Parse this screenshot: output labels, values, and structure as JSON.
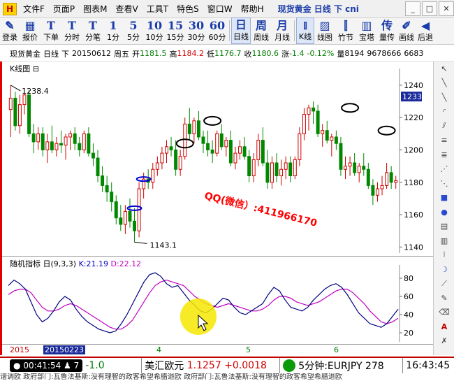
{
  "menubar": {
    "logo": "H",
    "items": [
      "文件F",
      "页面P",
      "图表M",
      "查看V",
      "工具T",
      "特色S",
      "窗口W",
      "帮助H"
    ],
    "title": "现货黄金 日线 下 cni",
    "window_buttons": [
      "_",
      "□",
      "✕"
    ]
  },
  "toolbar": {
    "buttons": [
      {
        "icon": "✎",
        "label": "登录"
      },
      {
        "icon": "▦",
        "label": "报价"
      },
      {
        "icon": "T",
        "label": "下单"
      },
      {
        "icon": "T",
        "label": "分时"
      },
      {
        "icon": "T",
        "label": "分笔"
      },
      {
        "icon": "1",
        "label": "1分"
      },
      {
        "icon": "5",
        "label": "5分"
      },
      {
        "icon": "10",
        "label": "10分"
      },
      {
        "icon": "15",
        "label": "15分"
      },
      {
        "icon": "30",
        "label": "30分"
      },
      {
        "icon": "60",
        "label": "60分"
      },
      {
        "icon": "日",
        "label": "日线"
      },
      {
        "icon": "周",
        "label": "周线"
      },
      {
        "icon": "月",
        "label": "月线"
      },
      {
        "icon": "⫾",
        "label": "K线"
      },
      {
        "icon": "▨",
        "label": "线图"
      },
      {
        "icon": "⫿",
        "label": "竹节"
      },
      {
        "icon": "▥",
        "label": "宝塔"
      },
      {
        "icon": "传",
        "label": "量传"
      },
      {
        "icon": "✐",
        "label": "画线"
      },
      {
        "icon": "◀",
        "label": "后退"
      }
    ]
  },
  "info": {
    "symbol": "现货黄金",
    "period": "日线",
    "mode": "下",
    "date": "20150612",
    "weekday": "周五",
    "open_label": "开",
    "open": "1181.5",
    "high_label": "高",
    "high": "1184.2",
    "low_label": "低",
    "low": "1176.7",
    "close_label": "收",
    "close": "1180.6",
    "change_label": "涨",
    "change": "-1.4",
    "change_pct": "-0.12%",
    "volume_label": "量",
    "volume": "8194",
    "amount": "9678666",
    "extra": "6683"
  },
  "chart": {
    "label": "K线图",
    "label_icon": "⊟",
    "watermark": "QQ(微信）:411966170",
    "high_marker": "1238.4",
    "low_marker": "1143.1",
    "current_price": "1233",
    "colors": {
      "up": "#d00000",
      "down": "#008800",
      "marker_blue": "#0000d0",
      "watermark": "#ff0000"
    }
  },
  "chart_data": {
    "type": "candlestick",
    "ylim": [
      1138,
      1246
    ],
    "y_ticks": [
      1140,
      1160,
      1180,
      1200,
      1220,
      1240
    ],
    "candles": [
      {
        "o": 1225,
        "h": 1240,
        "l": 1208,
        "c": 1232
      },
      {
        "o": 1232,
        "h": 1236,
        "l": 1212,
        "c": 1215
      },
      {
        "o": 1215,
        "h": 1234,
        "l": 1210,
        "c": 1228
      },
      {
        "o": 1228,
        "h": 1238,
        "l": 1222,
        "c": 1234
      },
      {
        "o": 1234,
        "h": 1237,
        "l": 1208,
        "c": 1210
      },
      {
        "o": 1210,
        "h": 1216,
        "l": 1198,
        "c": 1205
      },
      {
        "o": 1205,
        "h": 1214,
        "l": 1200,
        "c": 1210
      },
      {
        "o": 1210,
        "h": 1214,
        "l": 1196,
        "c": 1200
      },
      {
        "o": 1200,
        "h": 1210,
        "l": 1192,
        "c": 1205
      },
      {
        "o": 1205,
        "h": 1215,
        "l": 1198,
        "c": 1200
      },
      {
        "o": 1200,
        "h": 1208,
        "l": 1196,
        "c": 1204
      },
      {
        "o": 1204,
        "h": 1212,
        "l": 1198,
        "c": 1203
      },
      {
        "o": 1203,
        "h": 1210,
        "l": 1194,
        "c": 1208
      },
      {
        "o": 1208,
        "h": 1212,
        "l": 1200,
        "c": 1210
      },
      {
        "o": 1210,
        "h": 1214,
        "l": 1200,
        "c": 1204
      },
      {
        "o": 1204,
        "h": 1208,
        "l": 1196,
        "c": 1200
      },
      {
        "o": 1200,
        "h": 1212,
        "l": 1198,
        "c": 1210
      },
      {
        "o": 1210,
        "h": 1214,
        "l": 1196,
        "c": 1198
      },
      {
        "o": 1198,
        "h": 1204,
        "l": 1190,
        "c": 1195
      },
      {
        "o": 1195,
        "h": 1200,
        "l": 1180,
        "c": 1184
      },
      {
        "o": 1184,
        "h": 1190,
        "l": 1174,
        "c": 1178
      },
      {
        "o": 1178,
        "h": 1184,
        "l": 1168,
        "c": 1174
      },
      {
        "o": 1174,
        "h": 1180,
        "l": 1162,
        "c": 1168
      },
      {
        "o": 1168,
        "h": 1172,
        "l": 1154,
        "c": 1158
      },
      {
        "o": 1158,
        "h": 1166,
        "l": 1150,
        "c": 1154
      },
      {
        "o": 1154,
        "h": 1166,
        "l": 1148,
        "c": 1162
      },
      {
        "o": 1162,
        "h": 1170,
        "l": 1152,
        "c": 1156
      },
      {
        "o": 1156,
        "h": 1164,
        "l": 1143,
        "c": 1150
      },
      {
        "o": 1150,
        "h": 1180,
        "l": 1146,
        "c": 1176
      },
      {
        "o": 1176,
        "h": 1186,
        "l": 1170,
        "c": 1182
      },
      {
        "o": 1182,
        "h": 1188,
        "l": 1176,
        "c": 1180
      },
      {
        "o": 1180,
        "h": 1192,
        "l": 1176,
        "c": 1188
      },
      {
        "o": 1188,
        "h": 1196,
        "l": 1184,
        "c": 1192
      },
      {
        "o": 1192,
        "h": 1202,
        "l": 1188,
        "c": 1198
      },
      {
        "o": 1198,
        "h": 1206,
        "l": 1192,
        "c": 1202
      },
      {
        "o": 1202,
        "h": 1208,
        "l": 1196,
        "c": 1200
      },
      {
        "o": 1200,
        "h": 1206,
        "l": 1184,
        "c": 1188
      },
      {
        "o": 1188,
        "h": 1200,
        "l": 1184,
        "c": 1196
      },
      {
        "o": 1196,
        "h": 1220,
        "l": 1194,
        "c": 1216
      },
      {
        "o": 1216,
        "h": 1226,
        "l": 1206,
        "c": 1210
      },
      {
        "o": 1210,
        "h": 1220,
        "l": 1204,
        "c": 1218
      },
      {
        "o": 1218,
        "h": 1224,
        "l": 1206,
        "c": 1208
      },
      {
        "o": 1208,
        "h": 1212,
        "l": 1198,
        "c": 1204
      },
      {
        "o": 1204,
        "h": 1212,
        "l": 1196,
        "c": 1200
      },
      {
        "o": 1200,
        "h": 1206,
        "l": 1192,
        "c": 1198
      },
      {
        "o": 1198,
        "h": 1212,
        "l": 1196,
        "c": 1210
      },
      {
        "o": 1210,
        "h": 1216,
        "l": 1200,
        "c": 1202
      },
      {
        "o": 1202,
        "h": 1208,
        "l": 1196,
        "c": 1206
      },
      {
        "o": 1206,
        "h": 1212,
        "l": 1190,
        "c": 1192
      },
      {
        "o": 1192,
        "h": 1202,
        "l": 1188,
        "c": 1198
      },
      {
        "o": 1198,
        "h": 1206,
        "l": 1194,
        "c": 1202
      },
      {
        "o": 1202,
        "h": 1208,
        "l": 1194,
        "c": 1196
      },
      {
        "o": 1196,
        "h": 1200,
        "l": 1180,
        "c": 1184
      },
      {
        "o": 1184,
        "h": 1198,
        "l": 1180,
        "c": 1194
      },
      {
        "o": 1194,
        "h": 1210,
        "l": 1190,
        "c": 1206
      },
      {
        "o": 1206,
        "h": 1214,
        "l": 1190,
        "c": 1192
      },
      {
        "o": 1192,
        "h": 1200,
        "l": 1176,
        "c": 1180
      },
      {
        "o": 1180,
        "h": 1196,
        "l": 1176,
        "c": 1192
      },
      {
        "o": 1192,
        "h": 1198,
        "l": 1180,
        "c": 1184
      },
      {
        "o": 1184,
        "h": 1194,
        "l": 1178,
        "c": 1188
      },
      {
        "o": 1188,
        "h": 1196,
        "l": 1182,
        "c": 1192
      },
      {
        "o": 1192,
        "h": 1196,
        "l": 1180,
        "c": 1184
      },
      {
        "o": 1184,
        "h": 1196,
        "l": 1182,
        "c": 1194
      },
      {
        "o": 1194,
        "h": 1214,
        "l": 1190,
        "c": 1210
      },
      {
        "o": 1210,
        "h": 1226,
        "l": 1206,
        "c": 1222
      },
      {
        "o": 1222,
        "h": 1228,
        "l": 1212,
        "c": 1226
      },
      {
        "o": 1226,
        "h": 1230,
        "l": 1216,
        "c": 1224
      },
      {
        "o": 1224,
        "h": 1228,
        "l": 1208,
        "c": 1210
      },
      {
        "o": 1210,
        "h": 1216,
        "l": 1202,
        "c": 1212
      },
      {
        "o": 1212,
        "h": 1218,
        "l": 1204,
        "c": 1206
      },
      {
        "o": 1206,
        "h": 1210,
        "l": 1196,
        "c": 1208
      },
      {
        "o": 1208,
        "h": 1212,
        "l": 1200,
        "c": 1204
      },
      {
        "o": 1204,
        "h": 1208,
        "l": 1184,
        "c": 1188
      },
      {
        "o": 1188,
        "h": 1196,
        "l": 1182,
        "c": 1190
      },
      {
        "o": 1190,
        "h": 1196,
        "l": 1184,
        "c": 1192
      },
      {
        "o": 1192,
        "h": 1198,
        "l": 1184,
        "c": 1186
      },
      {
        "o": 1186,
        "h": 1192,
        "l": 1180,
        "c": 1190
      },
      {
        "o": 1190,
        "h": 1198,
        "l": 1184,
        "c": 1188
      },
      {
        "o": 1188,
        "h": 1192,
        "l": 1176,
        "c": 1178
      },
      {
        "o": 1178,
        "h": 1182,
        "l": 1166,
        "c": 1172
      },
      {
        "o": 1172,
        "h": 1180,
        "l": 1168,
        "c": 1176
      },
      {
        "o": 1176,
        "h": 1184,
        "l": 1172,
        "c": 1178
      },
      {
        "o": 1178,
        "h": 1192,
        "l": 1176,
        "c": 1186
      },
      {
        "o": 1186,
        "h": 1190,
        "l": 1176,
        "c": 1180
      },
      {
        "o": 1180,
        "h": 1184,
        "l": 1176,
        "c": 1181
      }
    ],
    "ellipse_markers": [
      {
        "index": 38,
        "price": 1204,
        "color": "black"
      },
      {
        "index": 44,
        "price": 1218,
        "color": "black"
      },
      {
        "index": 74,
        "price": 1226,
        "color": "black"
      },
      {
        "index": 82,
        "price": 1212,
        "color": "black"
      },
      {
        "index": 29,
        "price": 1182,
        "color": "blue"
      },
      {
        "index": 27,
        "price": 1164,
        "color": "blue"
      }
    ]
  },
  "indicator": {
    "name": "随机指标",
    "period_char": "日",
    "params": "(9,3,3)",
    "k_label": "K:21.19",
    "d_label": "D:22.12",
    "k_color": "#000080",
    "d_color": "#c000c0",
    "y_ticks": [
      20,
      40,
      60,
      80
    ],
    "ylim": [
      10,
      90
    ],
    "k": [
      72,
      78,
      74,
      68,
      54,
      40,
      32,
      36,
      44,
      54,
      60,
      56,
      46,
      38,
      32,
      28,
      24,
      22,
      20,
      22,
      30,
      40,
      52,
      64,
      76,
      84,
      86,
      82,
      74,
      70,
      72,
      64,
      56,
      50,
      44,
      42,
      46,
      52,
      58,
      56,
      48,
      42,
      40,
      44,
      48,
      52,
      62,
      70,
      66,
      56,
      48,
      46,
      44,
      48,
      56,
      62,
      68,
      72,
      74,
      70,
      62,
      52,
      42,
      36,
      30,
      28,
      26,
      30,
      38,
      46
    ],
    "d": [
      62,
      66,
      68,
      68,
      64,
      56,
      48,
      44,
      44,
      46,
      50,
      52,
      50,
      46,
      42,
      38,
      34,
      30,
      26,
      24,
      24,
      28,
      34,
      44,
      54,
      64,
      72,
      76,
      78,
      76,
      74,
      72,
      66,
      60,
      56,
      52,
      50,
      48,
      50,
      52,
      50,
      48,
      46,
      44,
      44,
      46,
      50,
      56,
      60,
      60,
      58,
      54,
      52,
      50,
      52,
      54,
      58,
      62,
      66,
      68,
      68,
      64,
      58,
      52,
      44,
      38,
      32,
      30,
      32,
      36
    ]
  },
  "xaxis": {
    "labels": [
      "2015",
      "20150223",
      "4",
      "5",
      "6"
    ]
  },
  "status": {
    "time": "00:41:54",
    "count": "7",
    "value": "-1.0",
    "pair1_name": "美汇欧元",
    "pair1_price": "1.1257",
    "pair1_change": "+0.0018",
    "pair2": "5分钟:EURJPY 278",
    "clock": "16:43:45"
  },
  "ticker": "谐调欧    政府部门:瓦鲁法基斯:没有理智的政客希望希腊退欧    政府部门:瓦鲁法基斯:没有理智的政客希望希腊退欧"
}
